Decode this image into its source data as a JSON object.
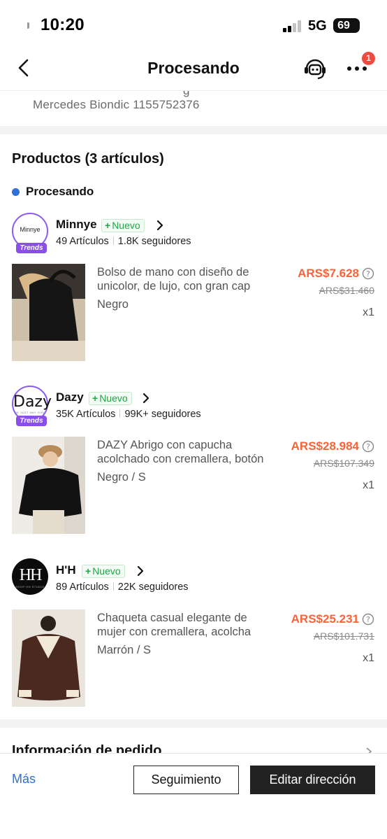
{
  "status_bar": {
    "time": "10:20",
    "network": "5G",
    "battery": "69"
  },
  "nav": {
    "title": "Procesando",
    "more_badge": "1"
  },
  "address": {
    "cut_line": "g",
    "name_phone": "Mercedes Biondic 1155752376"
  },
  "products": {
    "title": "Productos (3 artículos)",
    "status": "Procesando",
    "stores": [
      {
        "logo_text": "Minnye",
        "logo_tag": "Trends",
        "name": "Minnye",
        "badge": "Nuevo",
        "articles": "49 Artículos",
        "followers": "1.8K seguidores",
        "item": {
          "title": "Bolso de mano con diseño de unicolor, de lujo, con gran cap",
          "variant": "Negro",
          "price": "ARS$7.628",
          "original_price": "ARS$31.460",
          "qty": "x1"
        }
      },
      {
        "logo_text": "Dazy",
        "logo_sub": "BE JUST ANY GIRL",
        "logo_tag": "Trends",
        "name": "Dazy",
        "badge": "Nuevo",
        "articles": "35K Artículos",
        "followers": "99K+ seguidores",
        "item": {
          "title": "DAZY Abrigo con capucha acolchado con cremallera, botón",
          "variant": "Negro / S",
          "price": "ARS$28.984",
          "original_price": "ARS$107.349",
          "qty": "x1"
        }
      },
      {
        "logo_text": "HH",
        "logo_sub": "SHOP HH STUDIO",
        "name": "H'H",
        "badge": "Nuevo",
        "articles": "89 Artículos",
        "followers": "22K seguidores",
        "item": {
          "title": "Chaqueta casual elegante de mujer con cremallera, acolcha",
          "variant": "Marrón / S",
          "price": "ARS$25.231",
          "original_price": "ARS$101.731",
          "qty": "x1"
        }
      }
    ]
  },
  "order_info": {
    "title": "Información de pedido"
  },
  "bottom_bar": {
    "more": "Más",
    "track": "Seguimiento",
    "edit_address": "Editar dirección"
  },
  "colors": {
    "price": "#fa6338",
    "accent_blue": "#2e6fd8",
    "new_green": "#22a447",
    "trends_purple": "#8a4fe8",
    "badge_red": "#f04a3f"
  }
}
